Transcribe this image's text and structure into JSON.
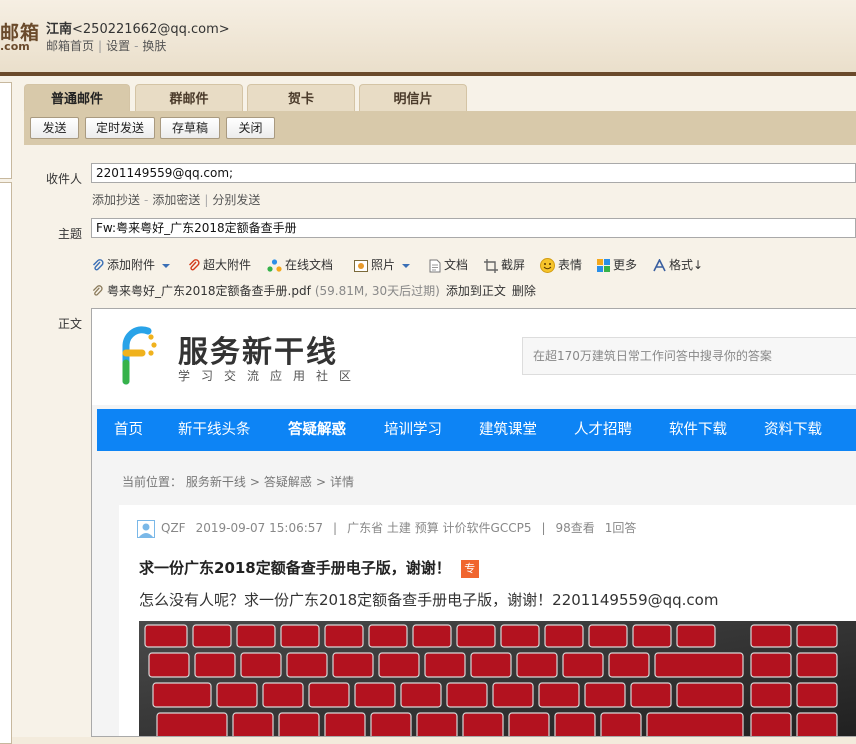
{
  "header": {
    "logo_main": "邮箱",
    "logo_sub": ".com",
    "user_name": "江南",
    "user_email": "<250221662@qq.com>",
    "links": [
      "邮箱首页",
      "设置",
      "换肤"
    ]
  },
  "tabs": [
    {
      "label": "普通邮件",
      "active": true
    },
    {
      "label": "群邮件",
      "active": false
    },
    {
      "label": "贺卡",
      "active": false
    },
    {
      "label": "明信片",
      "active": false
    }
  ],
  "toolbar": {
    "send": "发送",
    "schedule": "定时发送",
    "draft": "存草稿",
    "close": "关闭"
  },
  "form": {
    "to_label": "收件人",
    "to_value": "2201149559@qq.com;",
    "cc_links": [
      "添加抄送",
      "添加密送",
      "分别发送"
    ],
    "subject_label": "主题",
    "subject_value": "Fw:粤来粤好_广东2018定额备查手册",
    "body_label": "正文"
  },
  "attach_toolbar": [
    {
      "label": "添加附件",
      "icon": "paperclip-icon",
      "dropdown": true
    },
    {
      "label": "超大附件",
      "icon": "large-attachment-icon"
    },
    {
      "label": "在线文档",
      "icon": "online-doc-icon"
    },
    {
      "label": "照片",
      "icon": "photo-icon",
      "dropdown": true
    },
    {
      "label": "文档",
      "icon": "document-icon"
    },
    {
      "label": "截屏",
      "icon": "screenshot-icon"
    },
    {
      "label": "表情",
      "icon": "emoji-icon"
    },
    {
      "label": "更多",
      "icon": "more-icon"
    },
    {
      "label": "格式↓",
      "icon": "format-icon"
    }
  ],
  "attachment": {
    "name": "粤来粤好_广东2018定额备查手册.pdf",
    "meta": "(59.81M, 30天后过期)",
    "action_add": "添加到正文",
    "action_delete": "删除"
  },
  "web": {
    "brand": "服务新干线",
    "brand_sub": "学习交流应用社区",
    "search_placeholder": "在超170万建筑日常工作问答中搜寻你的答案",
    "nav": [
      {
        "label": "首页",
        "active": false
      },
      {
        "label": "新干线头条",
        "active": false
      },
      {
        "label": "答疑解惑",
        "active": true
      },
      {
        "label": "培训学习",
        "active": false
      },
      {
        "label": "建筑课堂",
        "active": false
      },
      {
        "label": "人才招聘",
        "active": false
      },
      {
        "label": "软件下载",
        "active": false
      },
      {
        "label": "资料下载",
        "active": false
      }
    ],
    "crumb_label": "当前位置：",
    "crumbs": [
      "服务新干线",
      "答疑解惑",
      "详情"
    ],
    "post": {
      "author": "QZF",
      "datetime": "2019-09-07 15:06:57",
      "tags": "广东省  土建 预算 计价软件GCCP5",
      "views": "98查看",
      "answers": "1回答",
      "title": "求一份广东2018定额备查手册电子版，谢谢！",
      "badge": "专",
      "text": "怎么没有人呢？求一份广东2018定额备查手册电子版，谢谢！2201149559@qq.com"
    },
    "colors": {
      "nav_blue": "#0d84f5",
      "badge_orange": "#f0652e"
    }
  }
}
